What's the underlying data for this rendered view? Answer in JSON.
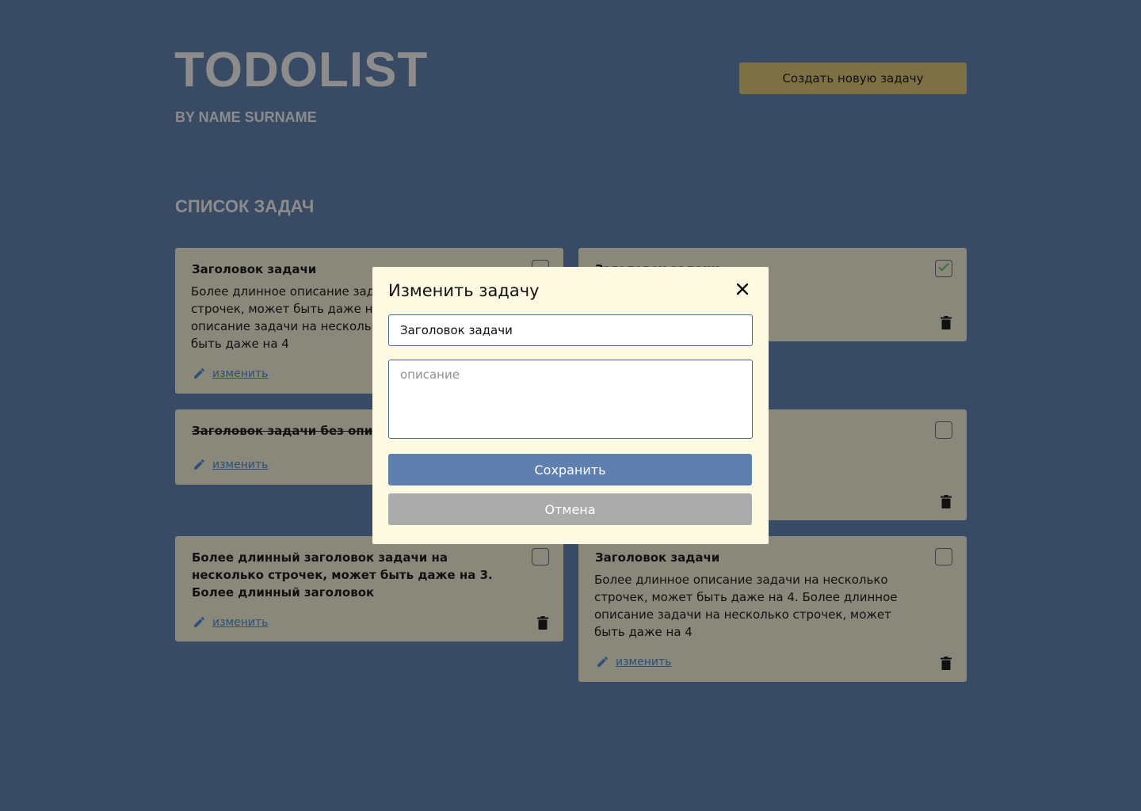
{
  "header": {
    "title": "TODOLIST",
    "subtitle": "BY NAME SURNAME",
    "create_button": "Создать новую задачу"
  },
  "section_title": "СПИСОК ЗАДАЧ",
  "tasks": [
    {
      "title": "Заголовок задачи",
      "description": "Более длинное описание задачи на несколько строчек, может быть даже на 4. Более длинное описание задачи на несколько строчек, может быть даже на 4",
      "edit_label": "изменить",
      "checked": false
    },
    {
      "title": "Заголовок задачи",
      "description": "",
      "edit_label": "",
      "checked": true
    },
    {
      "title": "Заголовок задачи без описания",
      "description": "",
      "edit_label": "изменить",
      "checked": true
    },
    {
      "title": "",
      "description": "",
      "edit_label": "",
      "checked": false
    },
    {
      "title": "Более длинный заголовок задачи на несколько строчек, может быть даже на 3. Более длинный заголовок",
      "description": "",
      "edit_label": "изменить",
      "checked": false
    },
    {
      "title": "Заголовок задачи",
      "description": "Более длинное описание задачи на несколько строчек, может быть даже на 4. Более длинное описание задачи на несколько строчек, может быть даже на 4",
      "edit_label": "изменить",
      "checked": false
    }
  ],
  "modal": {
    "title": "Изменить задачу",
    "title_value": "Заголовок задачи",
    "description_placeholder": "описание",
    "save_label": "Сохранить",
    "cancel_label": "Отмена"
  },
  "colors": {
    "background": "#384a64",
    "card": "#8a877b",
    "modal": "#fef9e1",
    "accent_button": "#7e7045",
    "save_button": "#5f7fae",
    "cancel_button": "#ababab",
    "link": "#2e4f7a",
    "check": "#2f6e3b"
  },
  "icons": {
    "edit": "pencil-icon",
    "delete": "trash-icon",
    "close": "close-icon",
    "check": "check-icon"
  }
}
